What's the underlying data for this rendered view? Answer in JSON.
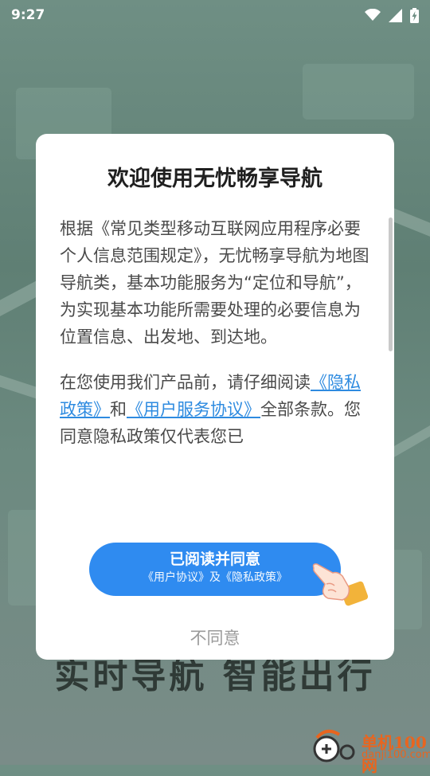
{
  "status_bar": {
    "time": "9:27",
    "icons": [
      "wifi-icon",
      "cell-signal-icon",
      "battery-charging-icon"
    ]
  },
  "background": {
    "slogan": "实时导航 智能出行"
  },
  "dialog": {
    "title": "欢迎使用无忧畅享导航",
    "paragraph1": "根据《常见类型移动互联网应用程序必要个人信息范围规定》，无忧畅享导航为地图导航类，基本功能服务为“定位和导航”，为实现基本功能所需要处理的必要信息为位置信息、出发地、到达地。",
    "paragraph2_prefix": "在您使用我们产品前，请仔细阅读",
    "privacy_link": "《隐私政策》",
    "conjunction": "和",
    "service_link": "《用户服务协议》",
    "paragraph2_suffix": "全部条款。您同意隐私政策仅代表您已",
    "agree_button": {
      "label": "已阅读并同意",
      "sublabel": "《用户协议》及《隐私政策》"
    },
    "disagree_button": "不同意",
    "accent_color": "#2f8bf0"
  },
  "watermark": {
    "name": "单机100网",
    "url": "danji100.com"
  }
}
